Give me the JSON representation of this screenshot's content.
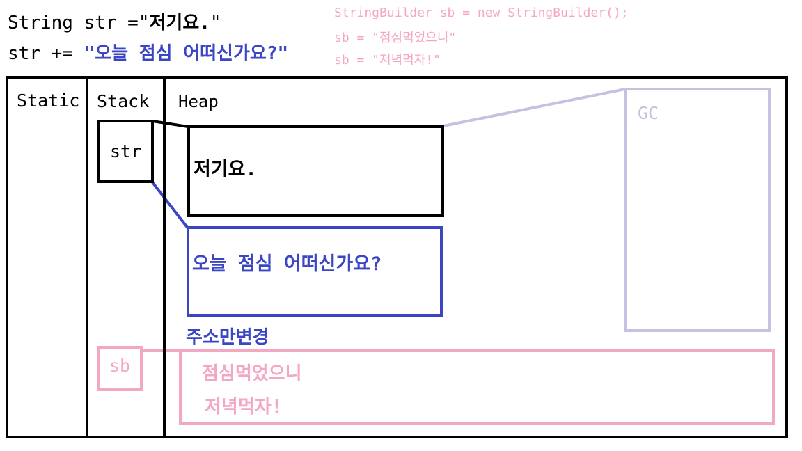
{
  "code": {
    "line1_prefix": "String str =\"",
    "line1_value": "저기요.",
    "line1_suffix": "\"",
    "line2_prefix": "str += ",
    "line2_value": "\"오늘 점심 어떠신가요?\"",
    "sb_line1": "StringBuilder sb = new StringBuilder();",
    "sb_line2": "sb = \"점심먹었으니\"",
    "sb_line3": "sb = \"저녁먹자!\""
  },
  "memory": {
    "static_label": "Static",
    "stack_label": "Stack",
    "heap_label": "Heap",
    "str_var": "str",
    "sb_var": "sb",
    "gc_label": "GC",
    "heap_obj1": "저기요.",
    "heap_obj2": "오늘 점심 어떠신가요?",
    "address_change_note": "주소만변경",
    "sb_text1": "점심먹었으니",
    "sb_text2": "저녁먹자!"
  },
  "colors": {
    "black": "#000000",
    "blue": "#3a46c4",
    "lavender": "#c7c0e0",
    "pink": "#f4a7c5"
  }
}
